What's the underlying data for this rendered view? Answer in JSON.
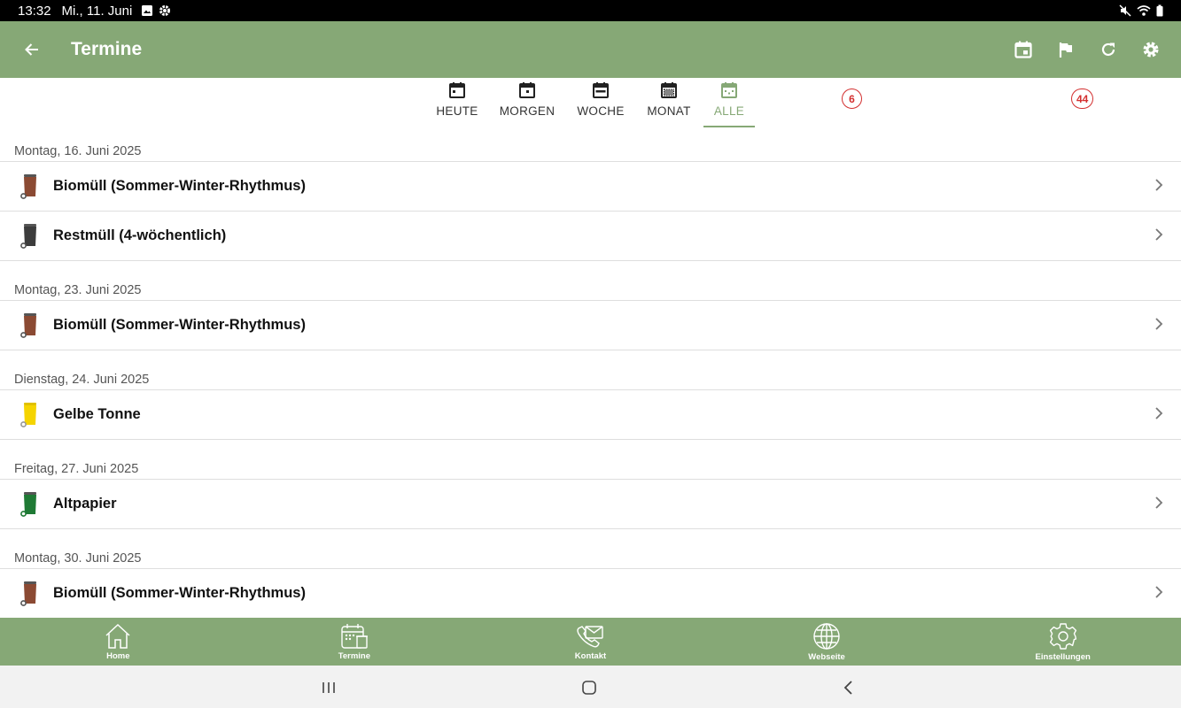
{
  "status_bar": {
    "time": "13:32",
    "date": "Mi., 11. Juni"
  },
  "app_bar": {
    "title": "Termine"
  },
  "tabs": [
    {
      "label": "HEUTE",
      "icon": "calendar-today-icon"
    },
    {
      "label": "MORGEN",
      "icon": "calendar-tomorrow-icon"
    },
    {
      "label": "WOCHE",
      "icon": "calendar-week-icon"
    },
    {
      "label": "MONAT",
      "icon": "calendar-month-icon"
    },
    {
      "label": "ALLE",
      "icon": "calendar-all-icon",
      "active": true
    }
  ],
  "badges": {
    "left": "6",
    "right": "44"
  },
  "groups": [
    {
      "date": "Montag, 16. Juni 2025",
      "items": [
        {
          "label": "Biomüll (Sommer-Winter-Rhythmus)",
          "bin_color": "#8b4a33"
        },
        {
          "label": "Restmüll (4-wöchentlich)",
          "bin_color": "#3c3c3c"
        }
      ]
    },
    {
      "date": "Montag, 23. Juni 2025",
      "items": [
        {
          "label": "Biomüll (Sommer-Winter-Rhythmus)",
          "bin_color": "#8b4a33"
        }
      ]
    },
    {
      "date": "Dienstag, 24. Juni 2025",
      "items": [
        {
          "label": "Gelbe Tonne",
          "bin_color": "#f5d400"
        }
      ]
    },
    {
      "date": "Freitag, 27. Juni 2025",
      "items": [
        {
          "label": "Altpapier",
          "bin_color": "#1f7a35"
        }
      ]
    },
    {
      "date": "Montag, 30. Juni 2025",
      "items": [
        {
          "label": "Biomüll (Sommer-Winter-Rhythmus)",
          "bin_color": "#8b4a33"
        }
      ]
    }
  ],
  "bottom_nav": [
    {
      "label": "Home",
      "icon": "home-icon"
    },
    {
      "label": "Termine",
      "icon": "calendar-bin-icon"
    },
    {
      "label": "Kontakt",
      "icon": "contact-phone-icon"
    },
    {
      "label": "Webseite",
      "icon": "globe-icon"
    },
    {
      "label": "Einstellungen",
      "icon": "gear-icon"
    }
  ],
  "colors": {
    "accent": "#86a876",
    "badge": "#d32f2f"
  }
}
